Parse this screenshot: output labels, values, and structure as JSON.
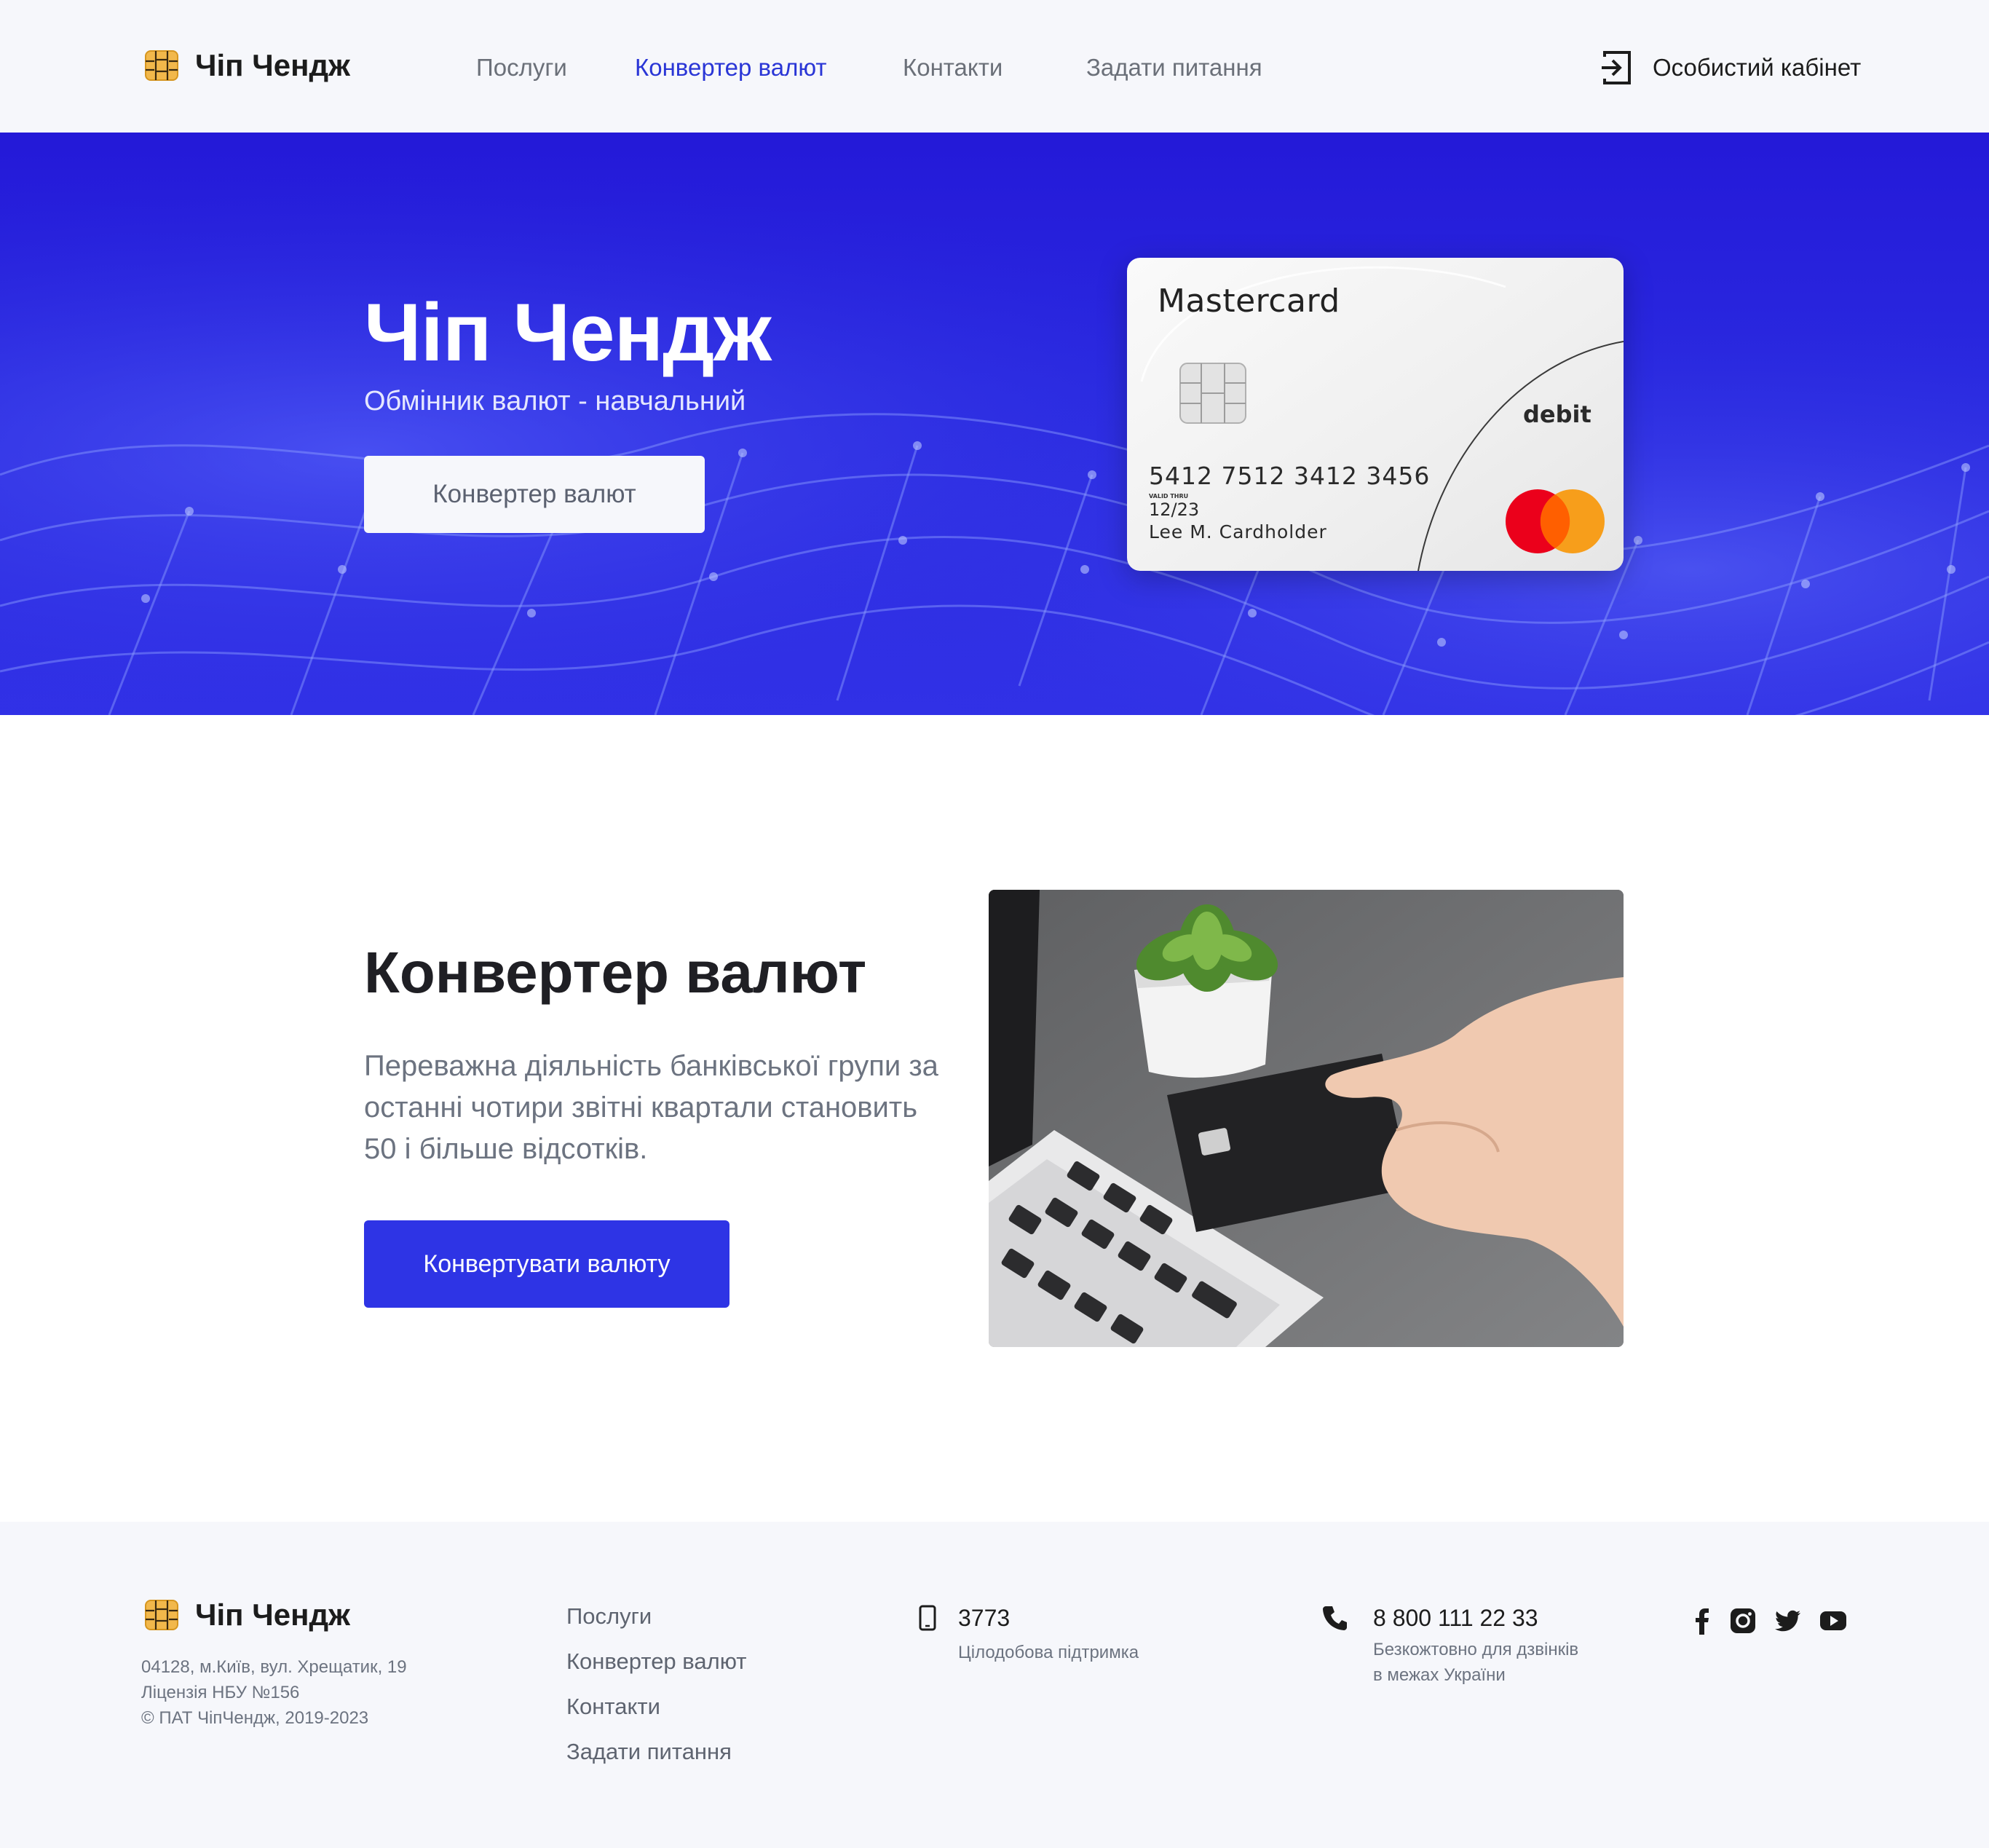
{
  "brand": {
    "name": "Чіп Чендж"
  },
  "nav": {
    "items": [
      {
        "label": "Послуги"
      },
      {
        "label": "Конвертер валют",
        "active": true
      },
      {
        "label": "Контакти"
      },
      {
        "label": "Задати питання"
      }
    ],
    "cabinet_label": "Особистий кабінет"
  },
  "hero": {
    "title": "Чіп Чендж",
    "subtitle": "Обмінник валют - навчальний",
    "button_label": "Конвертер валют"
  },
  "card": {
    "brand": "Mastercard",
    "type": "debit",
    "number": "5412 7512 3412 3456",
    "valid_label": "VALID THRU",
    "expiry": "12/23",
    "holder": "Lee M. Cardholder"
  },
  "converter": {
    "title": "Конвертер валют",
    "text": "Переважна діяльність банківської групи за останні чотири звітні квартали становить 50 і більше відсотків.",
    "button_label": "Конвертувати валюту"
  },
  "footer": {
    "address": "04128, м.Київ, вул. Хрещатик, 19",
    "license": "Ліцензія НБУ №156",
    "copyright": "© ПАТ ЧіпЧендж, 2019-2023",
    "links": [
      {
        "label": "Послуги"
      },
      {
        "label": "Конвертер валют"
      },
      {
        "label": "Контакти"
      },
      {
        "label": "Задати питання"
      }
    ],
    "mobile": {
      "value": "3773",
      "note": "Цілодобова підтримка"
    },
    "phone": {
      "value": "8 800 111 22 33",
      "note_line1": "Безкожтовно для дзвінків",
      "note_line2": "в межах України"
    },
    "social": [
      "facebook-icon",
      "instagram-icon",
      "twitter-icon",
      "youtube-icon"
    ]
  },
  "colors": {
    "accent": "#2e34e5",
    "nav_active": "#2a36d6",
    "hero_bg": "#2a2ae0",
    "header_bg": "#f6f7fb"
  }
}
